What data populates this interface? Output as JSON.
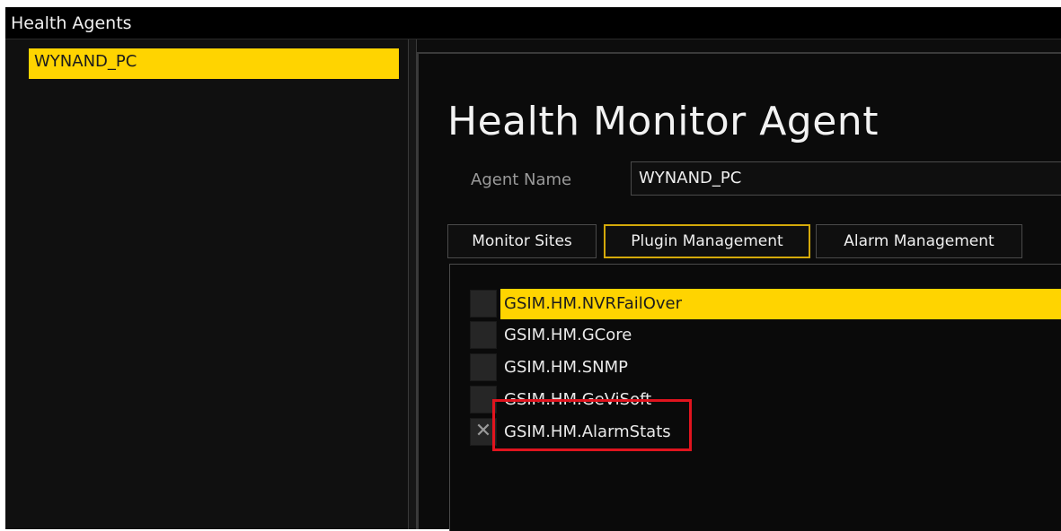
{
  "window": {
    "title": "Health Agents"
  },
  "sidebar": {
    "agents": [
      {
        "label": "WYNAND_PC",
        "selected": true
      }
    ]
  },
  "main": {
    "title": "Health Monitor Agent",
    "agent_name_label": "Agent Name",
    "agent_name_value": "WYNAND_PC",
    "tabs": [
      {
        "label": "Monitor Sites",
        "active": false
      },
      {
        "label": "Plugin Management",
        "active": true
      },
      {
        "label": "Alarm Management",
        "active": false
      }
    ],
    "plugins": [
      {
        "name": "GSIM.HM.NVRFailOver",
        "checked": false,
        "selected": true,
        "check_glyph": ""
      },
      {
        "name": "GSIM.HM.GCore",
        "checked": false,
        "selected": false,
        "check_glyph": ""
      },
      {
        "name": "GSIM.HM.SNMP",
        "checked": false,
        "selected": false,
        "check_glyph": ""
      },
      {
        "name": "GSIM.HM.GeViSoft",
        "checked": false,
        "selected": false,
        "check_glyph": ""
      },
      {
        "name": "GSIM.HM.AlarmStats",
        "checked": true,
        "selected": false,
        "check_glyph": "✕"
      }
    ]
  },
  "colors": {
    "accent": "#ffd400",
    "highlight_outline": "#e0141e",
    "background": "#0d0d0d"
  }
}
